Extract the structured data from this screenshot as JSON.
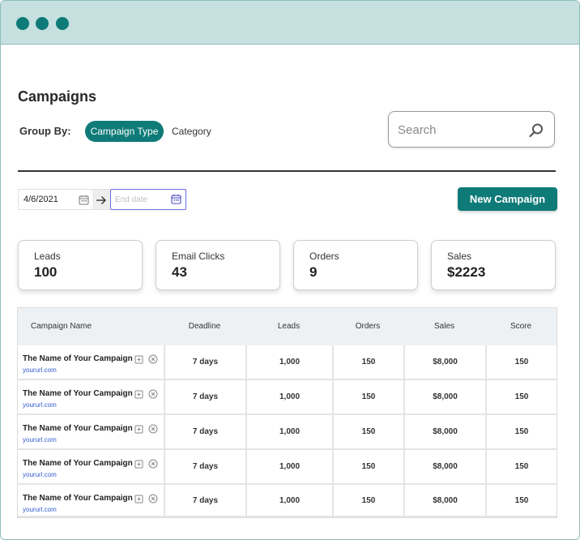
{
  "page": {
    "title": "Campaigns"
  },
  "group_by": {
    "label": "Group By:",
    "options": [
      "Campaign Type",
      "Category"
    ],
    "selected": "Campaign Type"
  },
  "search": {
    "placeholder": "Search"
  },
  "date_range": {
    "start": "4/6/2021",
    "end_placeholder": "End date"
  },
  "actions": {
    "new_campaign": "New Campaign"
  },
  "stats": [
    {
      "label": "Leads",
      "value": "100"
    },
    {
      "label": "Email Clicks",
      "value": "43"
    },
    {
      "label": "Orders",
      "value": "9"
    },
    {
      "label": "Sales",
      "value": "$2223"
    }
  ],
  "table": {
    "columns": [
      "Campaign Name",
      "Deadline",
      "Leads",
      "Orders",
      "Sales",
      "Score"
    ],
    "rows": [
      {
        "name": "The Name of Your Campaign",
        "url": "yoururl.com",
        "deadline": "7 days",
        "leads": "1,000",
        "orders": "150",
        "sales": "$8,000",
        "score": "150"
      },
      {
        "name": "The Name of Your Campaign",
        "url": "yoururl.com",
        "deadline": "7 days",
        "leads": "1,000",
        "orders": "150",
        "sales": "$8,000",
        "score": "150"
      },
      {
        "name": "The Name of Your Campaign",
        "url": "yoururl.com",
        "deadline": "7 days",
        "leads": "1,000",
        "orders": "150",
        "sales": "$8,000",
        "score": "150"
      },
      {
        "name": "The Name of Your Campaign",
        "url": "yoururl.com",
        "deadline": "7 days",
        "leads": "1,000",
        "orders": "150",
        "sales": "$8,000",
        "score": "150"
      },
      {
        "name": "The Name of Your Campaign",
        "url": "yoururl.com",
        "deadline": "7 days",
        "leads": "1,000",
        "orders": "150",
        "sales": "$8,000",
        "score": "150"
      }
    ]
  },
  "colors": {
    "accent": "#0f7b78",
    "titlebar": "#c5e0df",
    "link": "#2f5bd1",
    "focus_border": "#6b6bd6"
  },
  "icons": [
    "window-dot",
    "search-icon",
    "calendar-icon",
    "arrow-right-icon",
    "edit-icon",
    "remove-circle-icon"
  ]
}
